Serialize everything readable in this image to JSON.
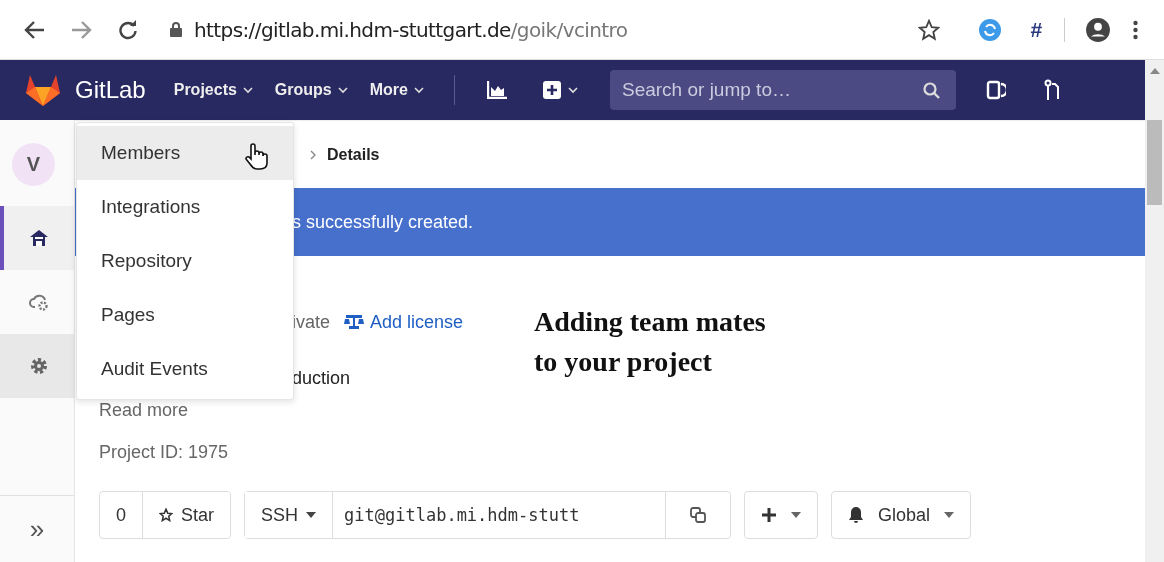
{
  "browser": {
    "url_host": "https://gitlab.mi.hdm-stuttgart.de",
    "url_path": "/goik/vcintro",
    "extension_label": "#"
  },
  "navbar": {
    "brand": "GitLab",
    "menus": [
      {
        "label": "Projects"
      },
      {
        "label": "Groups"
      },
      {
        "label": "More"
      }
    ],
    "search": {
      "placeholder": "Search or jump to…"
    }
  },
  "sidebar": {
    "avatar": "V",
    "items": [
      {
        "kind": "home",
        "selected": true,
        "hovered": false
      },
      {
        "kind": "operations",
        "selected": false,
        "hovered": false
      },
      {
        "kind": "settings",
        "selected": false,
        "hovered": true
      }
    ],
    "collapse": "»"
  },
  "dropdown": {
    "items": [
      {
        "label": "Members",
        "selected": true
      },
      {
        "label": "Integrations",
        "selected": false
      },
      {
        "label": "Repository",
        "selected": false
      },
      {
        "label": "Pages",
        "selected": false
      },
      {
        "label": "Audit Events",
        "selected": false
      }
    ]
  },
  "breadcrumb": {
    "current": "Details"
  },
  "flash": {
    "text": "s successfully created."
  },
  "project": {
    "visibility": "ivate",
    "license_link": "Add license",
    "description": "duction",
    "read_more": "Read more",
    "project_id": "Project ID: 1975"
  },
  "actions": {
    "star_count": "0",
    "star_label": "Star",
    "protocol": "SSH",
    "clone_url": "git@gitlab.mi.hdm-stutt",
    "notification": "Global"
  },
  "annotation": {
    "lines": [
      "Adding team mates",
      "to your project"
    ]
  }
}
